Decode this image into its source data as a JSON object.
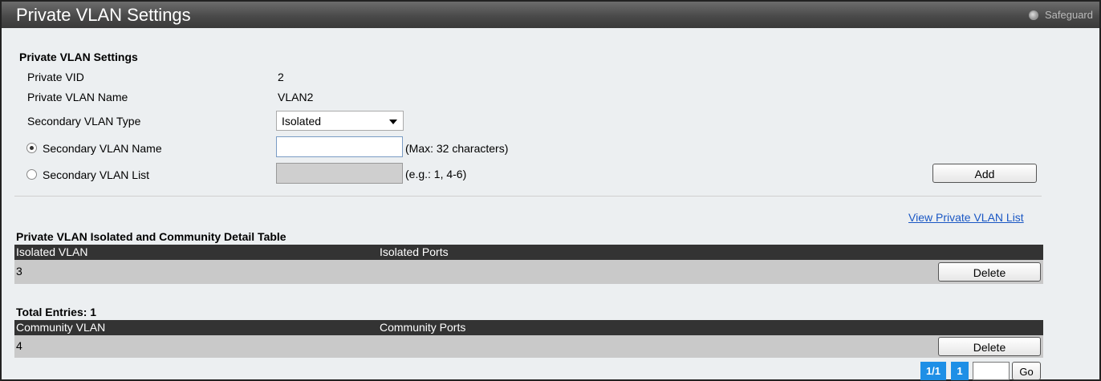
{
  "window": {
    "title": "Private VLAN Settings",
    "safeguard_label": "Safeguard"
  },
  "settings": {
    "section_title": "Private VLAN Settings",
    "private_vid_label": "Private VID",
    "private_vid_value": "2",
    "private_vlan_name_label": "Private VLAN Name",
    "private_vlan_name_value": "VLAN2",
    "secondary_type_label": "Secondary VLAN Type",
    "secondary_type_value": "Isolated",
    "secondary_name_label": "Secondary VLAN Name",
    "secondary_name_value": "",
    "secondary_name_hint": "(Max: 32 characters)",
    "secondary_list_label": "Secondary VLAN List",
    "secondary_list_value": "",
    "secondary_list_hint": "(e.g.: 1, 4-6)",
    "add_button": "Add",
    "selected_radio": "secondary_vlan_name"
  },
  "view_link": "View Private VLAN List",
  "detail_table": {
    "title": "Private VLAN Isolated and Community Detail Table",
    "isolated": {
      "headers": [
        "Isolated VLAN",
        "Isolated Ports"
      ],
      "rows": [
        {
          "vlan": "3",
          "ports": "",
          "delete_label": "Delete"
        }
      ]
    },
    "total_entries": "Total Entries: 1",
    "community": {
      "headers": [
        "Community VLAN",
        "Community Ports"
      ],
      "rows": [
        {
          "vlan": "4",
          "ports": "",
          "delete_label": "Delete"
        }
      ]
    }
  },
  "pagination": {
    "page_indicator": "1/1",
    "current_page": "1",
    "go_value": "",
    "go_label": "Go"
  },
  "colors": {
    "title_bar": "#4a4a4a",
    "table_header": "#333333",
    "table_row": "#c9c9c9",
    "link": "#1a57c4",
    "pagination": "#1e8fe6"
  }
}
